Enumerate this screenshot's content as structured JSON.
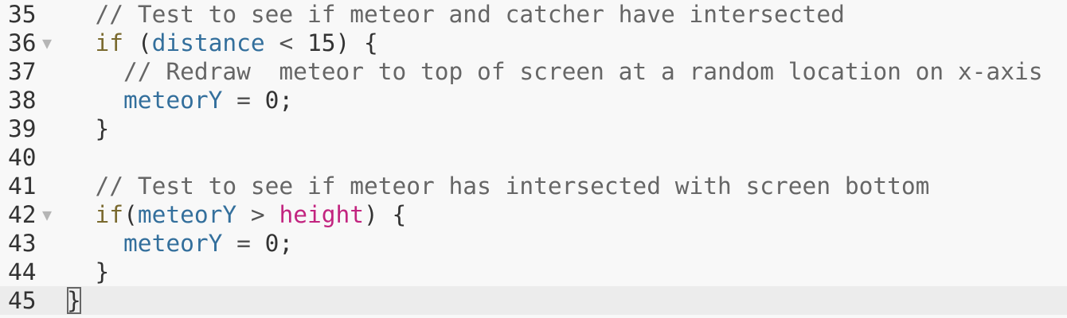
{
  "lines": [
    {
      "num": "35",
      "fold": "",
      "code": [
        {
          "t": "  "
        },
        {
          "t": "// Test to see if meteor and catcher have intersected",
          "c": "cm"
        }
      ]
    },
    {
      "num": "36",
      "fold": "▼",
      "code": [
        {
          "t": "  "
        },
        {
          "t": "if",
          "c": "kw"
        },
        {
          "t": " ("
        },
        {
          "t": "distance",
          "c": "var"
        },
        {
          "t": " < ",
          "c": "op"
        },
        {
          "t": "15) {"
        }
      ]
    },
    {
      "num": "37",
      "fold": "",
      "code": [
        {
          "t": "    "
        },
        {
          "t": "// Redraw  meteor to top of screen at a random location on x-axis",
          "c": "cm"
        }
      ]
    },
    {
      "num": "38",
      "fold": "",
      "code": [
        {
          "t": "    "
        },
        {
          "t": "meteorY",
          "c": "var"
        },
        {
          "t": " = ",
          "c": "op"
        },
        {
          "t": "0;"
        }
      ]
    },
    {
      "num": "39",
      "fold": "",
      "code": [
        {
          "t": "  }"
        }
      ]
    },
    {
      "num": "40",
      "fold": "",
      "code": []
    },
    {
      "num": "41",
      "fold": "",
      "code": [
        {
          "t": "  "
        },
        {
          "t": "// Test to see if meteor has intersected with screen bottom",
          "c": "cm"
        }
      ]
    },
    {
      "num": "42",
      "fold": "▼",
      "code": [
        {
          "t": "  "
        },
        {
          "t": "if",
          "c": "kw"
        },
        {
          "t": "("
        },
        {
          "t": "meteorY",
          "c": "var"
        },
        {
          "t": " > ",
          "c": "op"
        },
        {
          "t": "height",
          "c": "fn"
        },
        {
          "t": ") {"
        }
      ]
    },
    {
      "num": "43",
      "fold": "",
      "code": [
        {
          "t": "    "
        },
        {
          "t": "meteorY",
          "c": "var"
        },
        {
          "t": " = ",
          "c": "op"
        },
        {
          "t": "0;"
        }
      ]
    },
    {
      "num": "44",
      "fold": "",
      "code": [
        {
          "t": "  }"
        }
      ]
    },
    {
      "num": "45",
      "fold": "",
      "active": true,
      "code": [
        {
          "t": "}",
          "c": "cur"
        }
      ]
    }
  ]
}
